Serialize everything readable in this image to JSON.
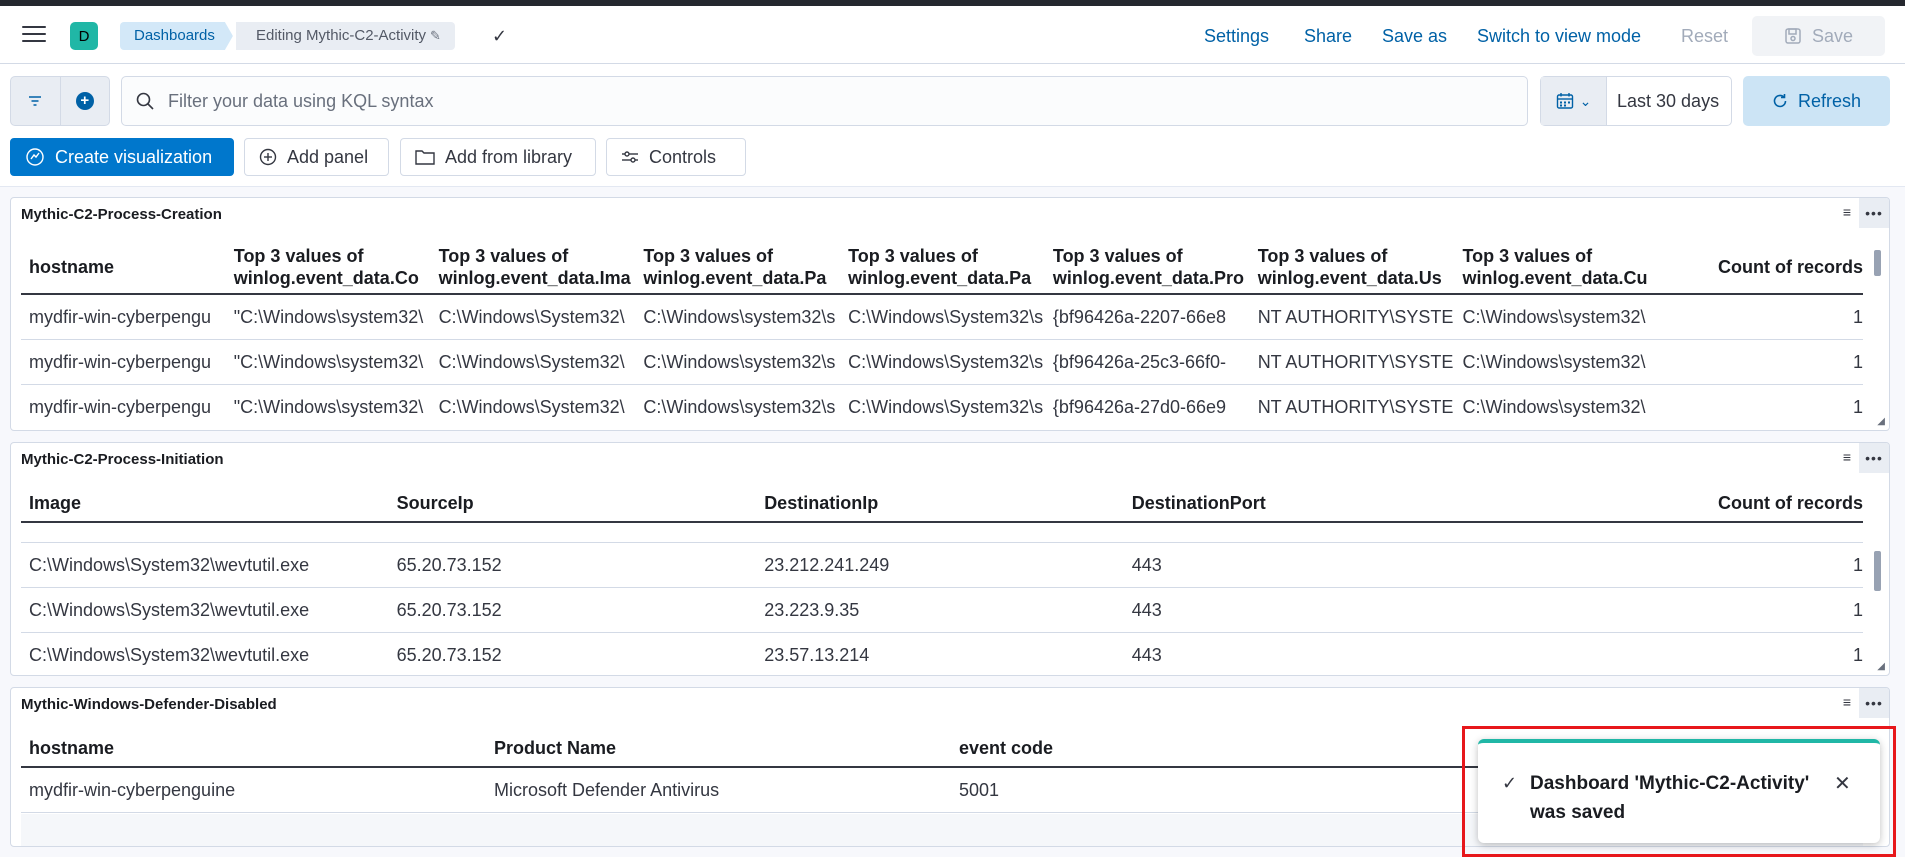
{
  "header": {
    "space_initial": "D",
    "breadcrumbs": [
      "Dashboards",
      "Editing Mythic-C2-Activity"
    ],
    "links": [
      "Settings",
      "Share",
      "Save as",
      "Switch to view mode",
      "Reset"
    ],
    "save_label": "Save"
  },
  "query": {
    "placeholder": "Filter your data using KQL syntax",
    "time_range": "Last 30 days",
    "refresh_label": "Refresh"
  },
  "toolbar": {
    "create_visualization": "Create visualization",
    "add_panel": "Add panel",
    "add_from_library": "Add from library",
    "controls": "Controls"
  },
  "panels": [
    {
      "title": "Mythic-C2-Process-Creation",
      "columns": [
        "hostname",
        "Top 3 values of winlog.event_data.Co",
        "Top 3 values of winlog.event_data.Ima",
        "Top 3 values of winlog.event_data.Pa",
        "Top 3 values of winlog.event_data.Pa",
        "Top 3 values of winlog.event_data.Pro",
        "Top 3 values of winlog.event_data.Us",
        "Top 3 values of winlog.event_data.Cu",
        "Count of records"
      ],
      "rows": [
        [
          "mydfir-win-cyberpengu",
          "\"C:\\Windows\\system32\\",
          "C:\\Windows\\System32\\",
          "C:\\Windows\\system32\\s",
          "C:\\Windows\\System32\\s",
          "{bf96426a-2207-66e8",
          "NT AUTHORITY\\SYSTEM",
          "C:\\Windows\\system32\\",
          "1"
        ],
        [
          "mydfir-win-cyberpengu",
          "\"C:\\Windows\\system32\\",
          "C:\\Windows\\System32\\",
          "C:\\Windows\\system32\\s",
          "C:\\Windows\\System32\\s",
          "{bf96426a-25c3-66f0-",
          "NT AUTHORITY\\SYSTEM",
          "C:\\Windows\\system32\\",
          "1"
        ],
        [
          "mydfir-win-cyberpengu",
          "\"C:\\Windows\\system32\\",
          "C:\\Windows\\System32\\",
          "C:\\Windows\\system32\\s",
          "C:\\Windows\\System32\\s",
          "{bf96426a-27d0-66e9",
          "NT AUTHORITY\\SYSTEM",
          "C:\\Windows\\system32\\",
          "1"
        ]
      ]
    },
    {
      "title": "Mythic-C2-Process-Initiation",
      "columns": [
        "Image",
        "SourceIp",
        "DestinationIp",
        "DestinationPort",
        "Count of records"
      ],
      "rows": [
        [
          "C:\\Windows\\System32\\wevtutil.exe",
          "65.20.73.152",
          "23.212.241.249",
          "443",
          "1"
        ],
        [
          "C:\\Windows\\System32\\wevtutil.exe",
          "65.20.73.152",
          "23.223.9.35",
          "443",
          "1"
        ],
        [
          "C:\\Windows\\System32\\wevtutil.exe",
          "65.20.73.152",
          "23.57.13.214",
          "443",
          "1"
        ]
      ]
    },
    {
      "title": "Mythic-Windows-Defender-Disabled",
      "columns": [
        "hostname",
        "Product Name",
        "event code"
      ],
      "rows": [
        [
          "mydfir-win-cyberpenguine",
          "Microsoft Defender Antivirus",
          "5001"
        ]
      ]
    }
  ],
  "toast": {
    "message": "Dashboard 'Mythic-C2-Activity' was saved"
  }
}
